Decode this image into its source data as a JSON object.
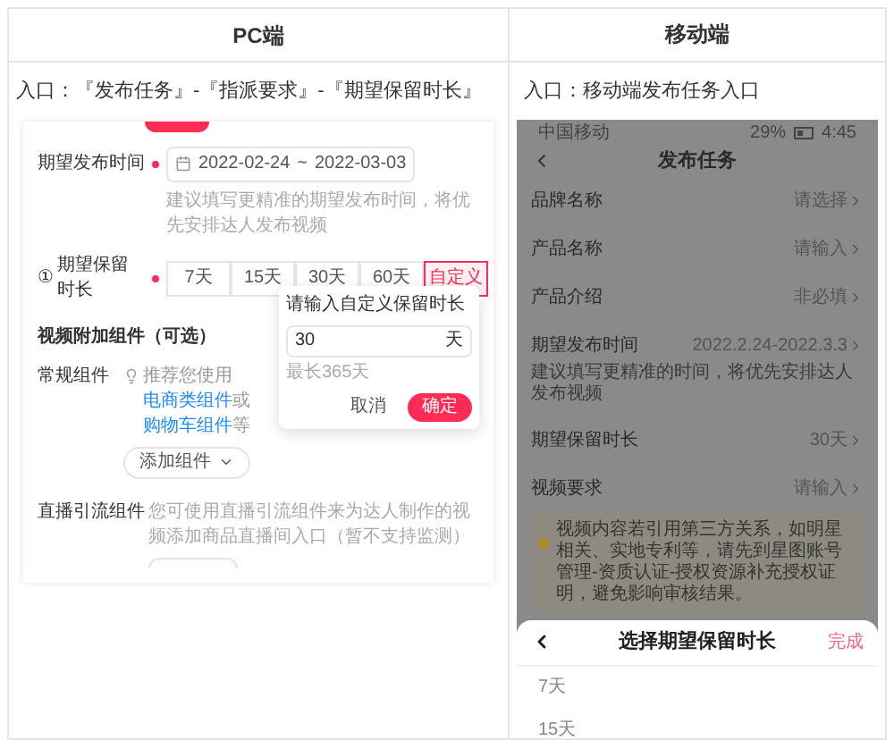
{
  "columns": [
    {
      "title": "PC端",
      "entry": "入口：『发布任务』-『指派要求』-『期望保留时长』"
    },
    {
      "title": "移动端",
      "entry": "入口：移动端发布任务入口"
    }
  ],
  "pc": {
    "publish_time": {
      "label": "期望发布时间",
      "required": true,
      "start": "2022-02-24",
      "separator": "~",
      "end": "2022-03-03",
      "hint": "建议填写更精准的期望发布时间，将优先安排达人发布视频"
    },
    "retention": {
      "prefix": "①",
      "label": "期望保留时长",
      "required": true,
      "options": [
        {
          "label": "7天",
          "selected": false
        },
        {
          "label": "15天",
          "selected": false
        },
        {
          "label": "30天",
          "selected": false
        },
        {
          "label": "60天",
          "selected": false
        },
        {
          "label": "自定义",
          "selected": true
        }
      ]
    },
    "popover": {
      "title": "请输入自定义保留时长",
      "value": "30",
      "unit": "天",
      "hint": "最长365天",
      "cancel": "取消",
      "confirm": "确定"
    },
    "addons": {
      "title": "视频附加组件（可选）",
      "regular_label": "常规组件",
      "regular_hint_parts": [
        "推荐您使用",
        "电商类组件",
        "或",
        "购物车组件",
        "等"
      ],
      "add_button": "添加组件",
      "live_label": "直播引流组件",
      "live_hint": "您可使用直播引流组件来为达人制作的视频添加商品直播间入口（暂不支持监测）"
    }
  },
  "mobile": {
    "status": {
      "carrier": "中国移动",
      "battery_text": "29%",
      "time": "4:45"
    },
    "title": "发布任务",
    "rows": [
      {
        "label": "品牌名称",
        "value": "请选择"
      },
      {
        "label": "产品名称",
        "value": "请输入"
      },
      {
        "label": "产品介绍",
        "value": "非必填"
      },
      {
        "label": "期望发布时间",
        "value": "2022.2.24-2022.3.3",
        "hint": "建议填写更精准的时间，将优先安排达人发布视频"
      },
      {
        "label": "期望保留时长",
        "value": "30天"
      },
      {
        "label": "视频要求",
        "value": "请输入"
      }
    ],
    "notice": "视频内容若引用第三方关系，如明星相关、实地专利等，请先到星图账号管理-资质认证-授权资源补充授权证明，避免影响审核结果。",
    "sheet": {
      "title": "选择期望保留时长",
      "done": "完成",
      "options": [
        {
          "label": "7天"
        },
        {
          "label": "15天"
        }
      ]
    }
  }
}
